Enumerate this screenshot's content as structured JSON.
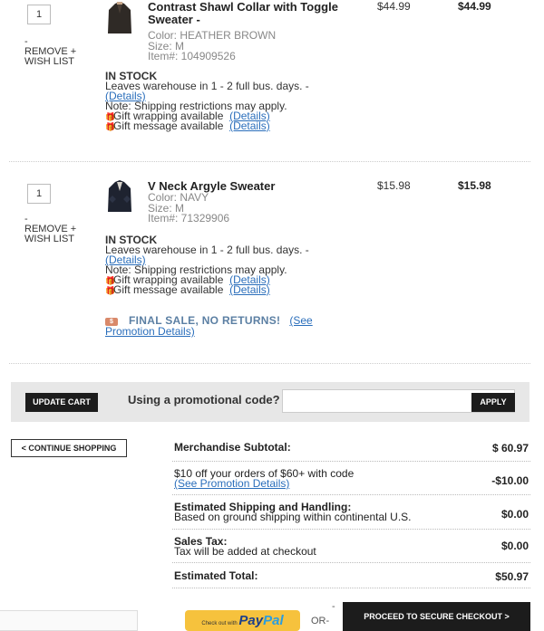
{
  "items": [
    {
      "qty": "1",
      "dash": "-",
      "remove_label": "REMOVE + WISH LIST",
      "name_line1": "Contrast Shawl Collar with Toggle",
      "name_line2": "Sweater -",
      "color": "Color: HEATHER BROWN",
      "size": "Size: M",
      "item_no": "Item#: 104909526",
      "price": "$44.99",
      "total": "$44.99",
      "stock": "IN STOCK",
      "leaves": "Leaves warehouse in 1 - 2 full bus. days. -",
      "details_link": "(Details)",
      "shipping_note": "Note: Shipping restrictions may apply.",
      "gift_wrap": "Gift wrapping available",
      "gift_wrap_link": "(Details)",
      "gift_msg": "Gift message available",
      "gift_msg_link": "(Details)",
      "thumb_color": "#2f2a26"
    },
    {
      "qty": "1",
      "dash": "-",
      "remove_label": "REMOVE + WISH LIST",
      "name_line1": "V Neck Argyle Sweater",
      "color": "Color: NAVY",
      "size": "Size: M",
      "item_no": "Item#: 71329906",
      "price": "$15.98",
      "total": "$15.98",
      "stock": "IN STOCK",
      "leaves": "Leaves warehouse in 1 - 2 full bus. days. -",
      "details_link": "(Details)",
      "shipping_note": "Note: Shipping restrictions may apply.",
      "gift_wrap": "Gift wrapping available",
      "gift_wrap_link": "(Details)",
      "gift_msg": "Gift message available",
      "gift_msg_link": "(Details)",
      "final_sale": "FINAL SALE, NO RETURNS!",
      "final_sale_icon": "$",
      "promo_link_1": "(See",
      "promo_link_2": "Promotion Details)",
      "thumb_color": "#1e2330"
    }
  ],
  "promo": {
    "update_cart": "UPDATE CART",
    "question": "Using a promotional code?",
    "input_value": "",
    "apply": "APPLY"
  },
  "continue_shopping": "< CONTINUE SHOPPING",
  "summary": {
    "subtotal_label": "Merchandise Subtotal:",
    "subtotal_value": "$ 60.97",
    "discount_line1": "$10 off your orders of $60+ with code",
    "discount_link": "(See Promotion Details)",
    "discount_value": "-$10.00",
    "shipping_label": "Estimated Shipping and Handling:",
    "shipping_sub": "Based on ground shipping within continental U.S.",
    "shipping_value": "$0.00",
    "tax_label": "Sales Tax:",
    "tax_sub": "Tax will be added at checkout",
    "tax_value": "$0.00",
    "total_label": "Estimated Total:",
    "total_value": "$50.97"
  },
  "checkout": {
    "paypal_prefix": "Check out with",
    "paypal_pay": "Pay",
    "paypal_pal": "Pal",
    "or_dash": "-",
    "or_label": "OR-",
    "secure_checkout": "PROCEED TO SECURE CHECKOUT >"
  }
}
